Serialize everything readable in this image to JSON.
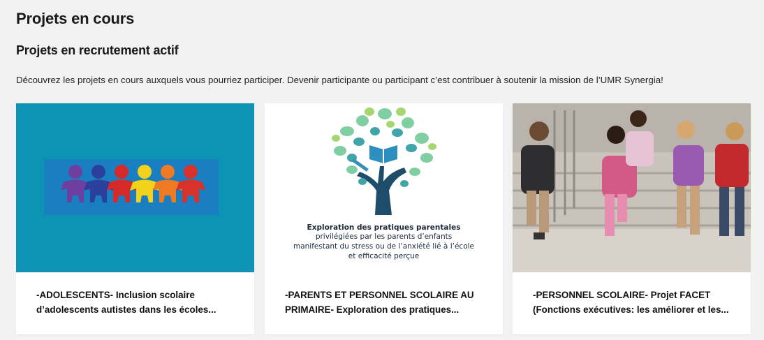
{
  "page": {
    "title": "Projets en cours",
    "section_title": "Projets en recrutement actif",
    "intro": "Découvrez les projets en cours auxquels vous pourriez participer. Devenir participante ou participant c’est contribuer à soutenir la mission de l’UMR Synergia!"
  },
  "cards": [
    {
      "caption_line1": "-ADOLESCENTS- Inclusion scolaire",
      "caption_line2": "d’adolescents autistes dans les écoles...",
      "image": "children-silhouettes-illustration",
      "colors": {
        "bg": "#0d93b4",
        "band": "#1a7fc0"
      }
    },
    {
      "caption_line1": "-PARENTS ET PERSONNEL SCOLAIRE AU",
      "caption_line2": "PRIMAIRE- Exploration des pratiques...",
      "image": "tree-hand-book-logo",
      "logo_title": "Exploration des pratiques parentales",
      "logo_line1": "privilégiées par les parents d’enfants",
      "logo_line2": "manifestant du stress ou de l’anxiété lié à l’école",
      "logo_line3": "et efficacité perçue"
    },
    {
      "caption_line1": "-PERSONNEL SCOLAIRE- Projet FACET",
      "caption_line2": "(Fonctions exécutives: les améliorer et les...",
      "image": "children-running-to-school-photo"
    }
  ]
}
